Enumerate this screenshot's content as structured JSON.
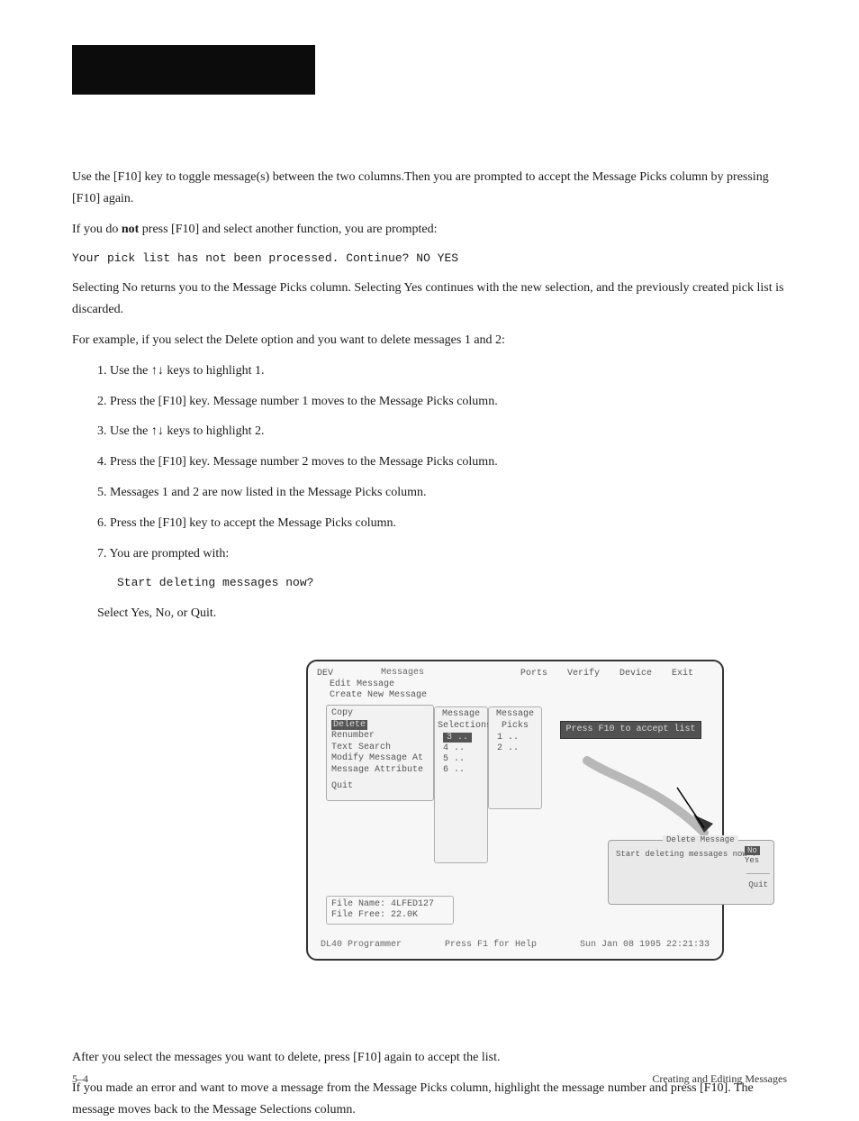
{
  "text": {
    "p1": "Use the [F10] key to toggle message(s) between the two columns.Then you are prompted to accept the Message Picks column by pressing [F10] again.",
    "p2_intro": "If you do",
    "p2_bold": "not",
    "p2_rest": "press [F10] and select another function, you are prompted:",
    "prompt": "Your pick list has not been processed. Continue?  NO  YES",
    "after_prompt": "Selecting No returns you to the Message Picks column.  Selecting Yes continues with the new selection, and the previously created pick list is discarded.",
    "p3": "For example, if you select the Delete option and you want to delete messages 1 and 2:",
    "step1": "1. Use the ↑↓ keys to highlight 1.",
    "step2": "2. Press the [F10] key.  Message number 1 moves to the Message Picks column.",
    "step3": "3. Use the ↑↓ keys to highlight 2.",
    "step4": "4. Press the [F10] key.  Message number 2 moves to the Message Picks column.",
    "step5": "5. Messages 1 and 2 are now listed in the Message Picks column.",
    "step6": "6. Press the [F10] key to accept the Message Picks column.",
    "step7a": "7. You are prompted with:",
    "step7_prompt": "Start deleting messages now?",
    "step7b": "Select Yes, No, or Quit.",
    "p_after_fig1": "After you select the messages you want to delete, press [F10] again to accept the list.",
    "p_after_fig2": "If you made an error and want to move a message from the Message Picks column, highlight the message number and press [F10].  The message moves back to the Message Selections column.",
    "footer_left": "5–4",
    "footer_right": "Creating and Editing Messages"
  },
  "fig": {
    "menubar": {
      "dev": "DEV",
      "ports": "Ports",
      "verify": "Verify",
      "device": "Device",
      "exit": "Exit"
    },
    "msg_title": "Messages",
    "first_panel": {
      "edit": "Edit Message",
      "create": "Create New Message"
    },
    "sub_panel": {
      "copy": "Copy",
      "delete": "Delete",
      "renumber": "Renumber",
      "text_search": "Text Search",
      "modify": "Modify Message At",
      "attribute": "Message Attribute",
      "quit": "Quit"
    },
    "sel": {
      "hdr1": "Message",
      "hdr2": "Selections",
      "items": [
        "3 ..",
        "4 ..",
        "5 ..",
        "6 .."
      ]
    },
    "pick": {
      "hdr1": "Message",
      "hdr2": "Picks",
      "items": [
        "1 ..",
        "2 .."
      ]
    },
    "accept": "Press F10 to accept list",
    "file": {
      "name_lbl": "File Name:",
      "name": "4LFED127",
      "free_lbl": "File Free:",
      "free": "22.0K"
    },
    "status": {
      "left": "DL40 Programmer",
      "mid": "Press F1 for Help",
      "right": "Sun Jan 08 1995 22:21:33"
    },
    "popup": {
      "title": "Delete Message",
      "text": "Start deleting messages now ?",
      "no": "No",
      "yes": "Yes",
      "quit": "Quit"
    }
  }
}
